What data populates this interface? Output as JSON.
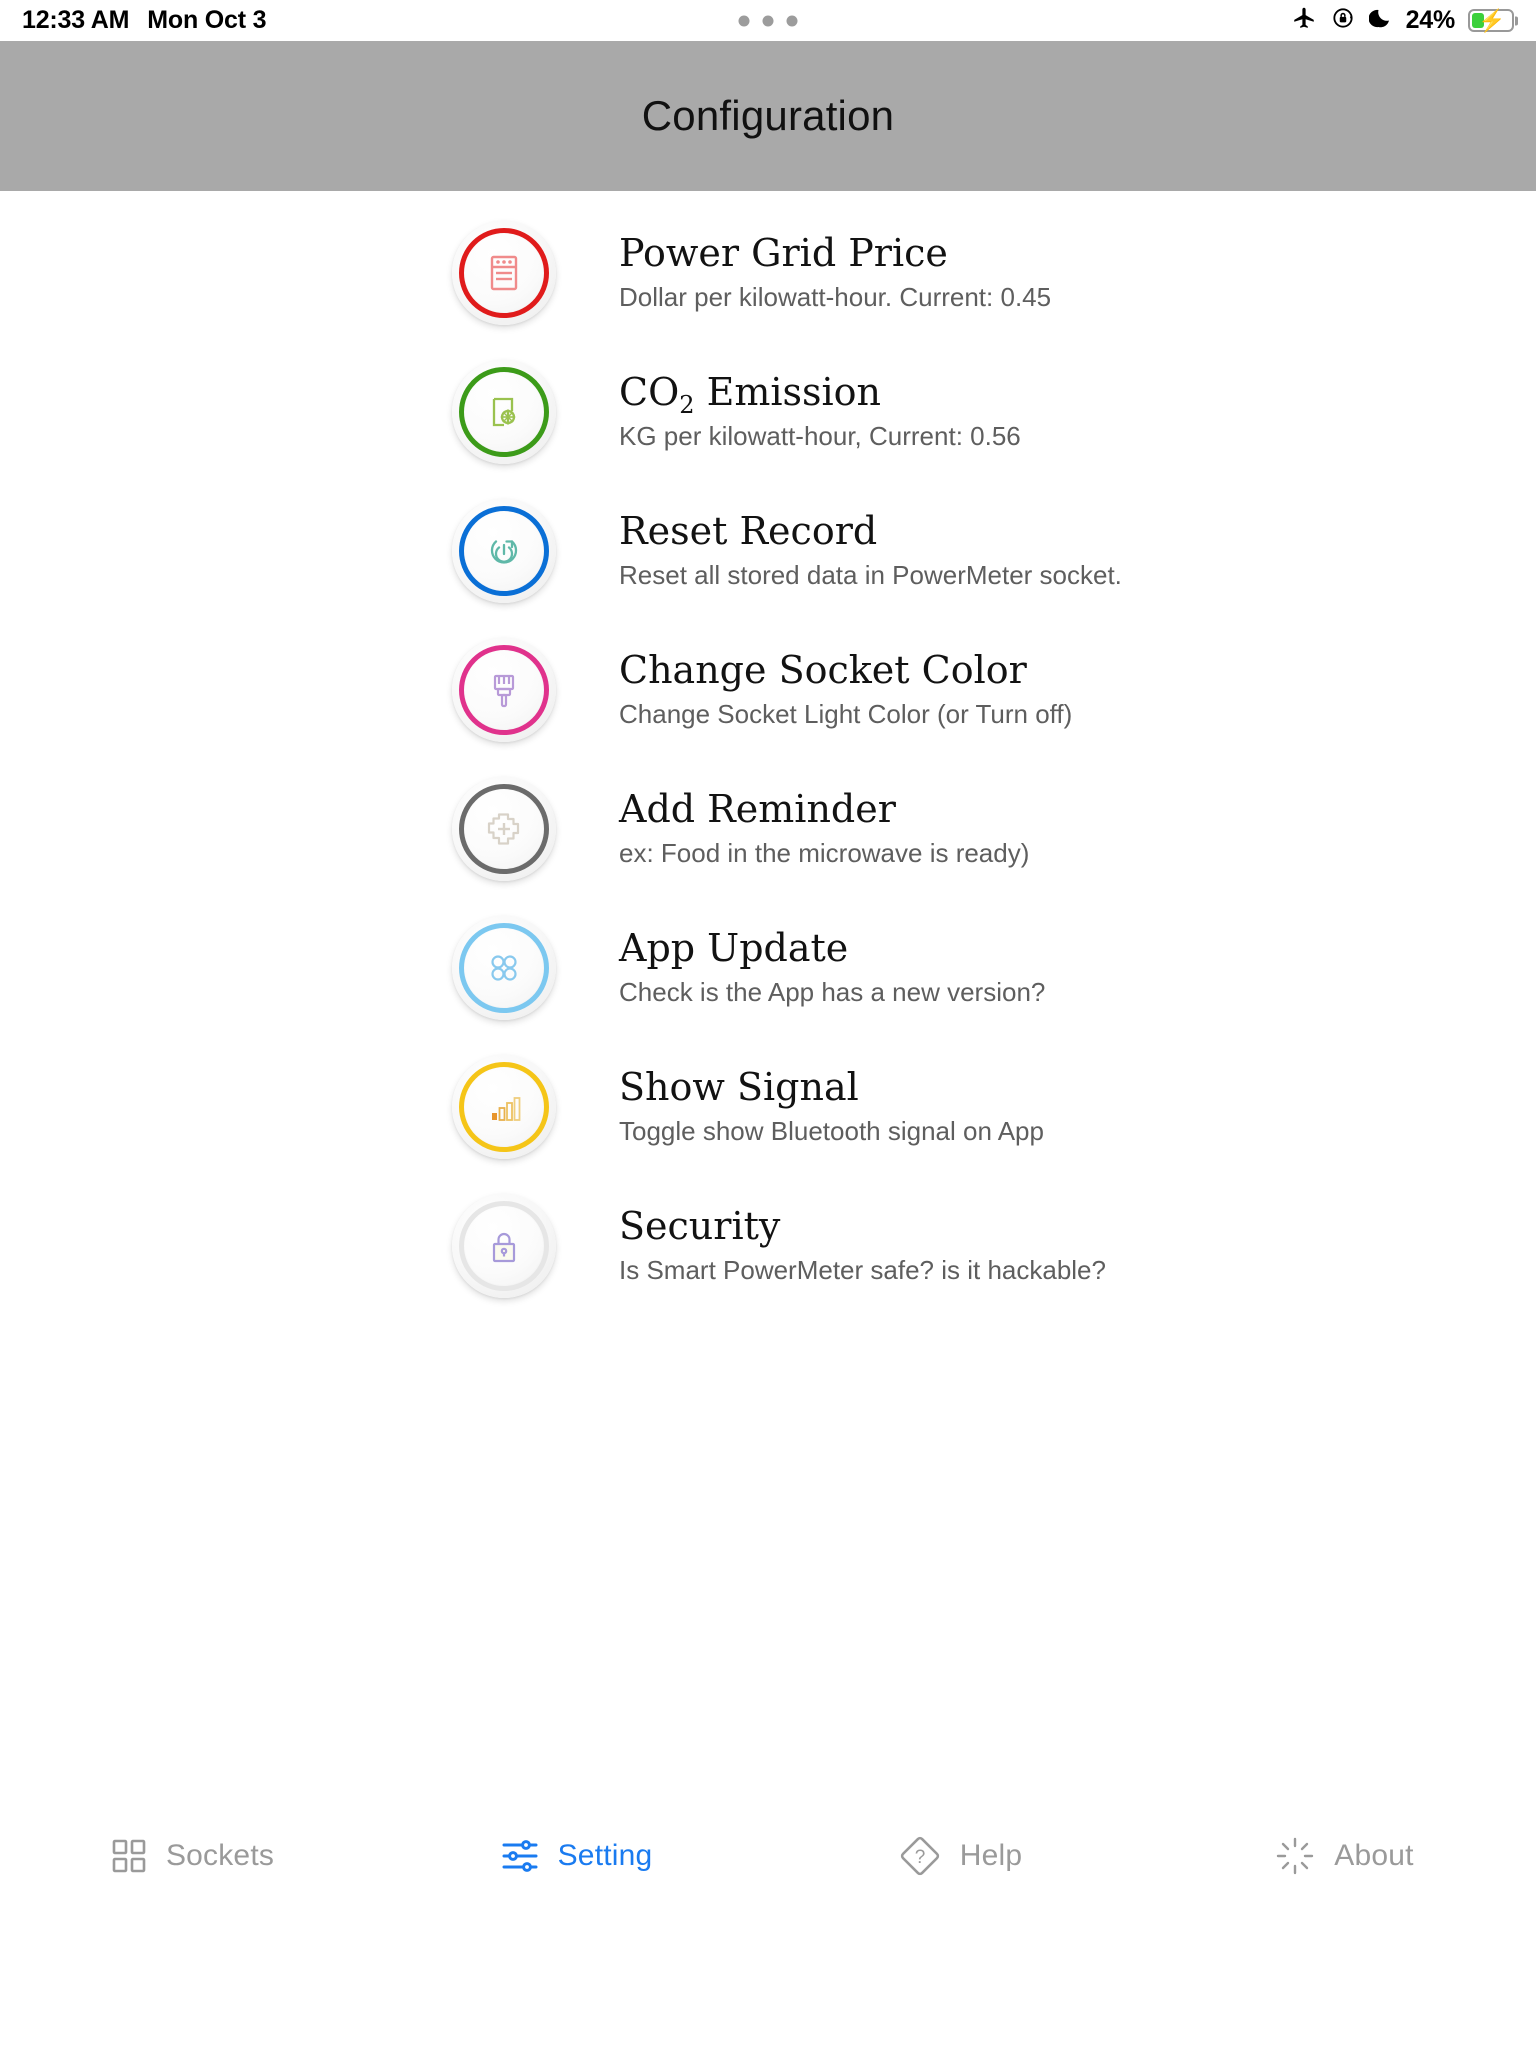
{
  "statusbar": {
    "time": "12:33 AM",
    "date": "Mon Oct 3",
    "battery_percent": "24%",
    "icons": [
      "airplane-mode-icon",
      "rotation-lock-icon",
      "do-not-disturb-moon-icon",
      "battery-charging-icon"
    ],
    "battery_level": 24,
    "battery_color": "#3cd03c"
  },
  "header": {
    "title": "Configuration",
    "background": "#a9a9a9"
  },
  "settings": {
    "items": [
      {
        "icon": "meter-document-icon",
        "accent": "#e01b1b",
        "icon_color": "#f08b8b",
        "title": "Power Grid Price",
        "subtitle": "Dollar per kilowatt-hour. Current: 0.45",
        "value": "0.45",
        "unit": "Dollar per kilowatt-hour"
      },
      {
        "icon": "document-gear-icon",
        "accent": "#3c9b19",
        "icon_color": "#9ac24f",
        "title": "CO2 Emission",
        "title_main": "CO",
        "title_sub": "2",
        "title_rest": " Emission",
        "subtitle": "KG per kilowatt-hour, Current: 0.56",
        "value": "0.56",
        "unit": "KG per kilowatt-hour"
      },
      {
        "icon": "power-reset-icon",
        "accent": "#0a6fd6",
        "icon_color": "#5fb8a8",
        "title": "Reset Record",
        "subtitle": "Reset all stored data in PowerMeter socket."
      },
      {
        "icon": "paintbrush-icon",
        "accent": "#e0328c",
        "icon_color": "#b89ad8",
        "title": "Change Socket Color",
        "subtitle": "Change Socket Light Color (or Turn off)"
      },
      {
        "icon": "gear-plus-icon",
        "accent": "#6b6b6b",
        "icon_color": "#d8d2c8",
        "title": "Add Reminder",
        "subtitle": "ex: Food in the microwave is ready)"
      },
      {
        "icon": "four-circles-icon",
        "accent": "#7cc8f0",
        "icon_color": "#89c9ee",
        "title": "App Update",
        "subtitle": "Check is the App has a new version?"
      },
      {
        "icon": "signal-bars-icon",
        "accent": "#f5c518",
        "icon_color": "#e8a33d",
        "title": "Show Signal",
        "subtitle": "Toggle show Bluetooth signal on App"
      },
      {
        "icon": "lock-icon",
        "accent": "#e3e3e3",
        "icon_color": "#a79ada",
        "title": "Security",
        "subtitle": "Is Smart PowerMeter safe? is it hackable?"
      }
    ]
  },
  "tabbar": {
    "active_color": "#1a7bf0",
    "inactive_color": "#9a9a9a",
    "tabs": [
      {
        "label": "Sockets",
        "icon": "grid-squares-icon",
        "active": false
      },
      {
        "label": "Setting",
        "icon": "sliders-icon",
        "active": true
      },
      {
        "label": "Help",
        "icon": "question-diamond-icon",
        "active": false
      },
      {
        "label": "About",
        "icon": "sunburst-icon",
        "active": false
      }
    ]
  }
}
